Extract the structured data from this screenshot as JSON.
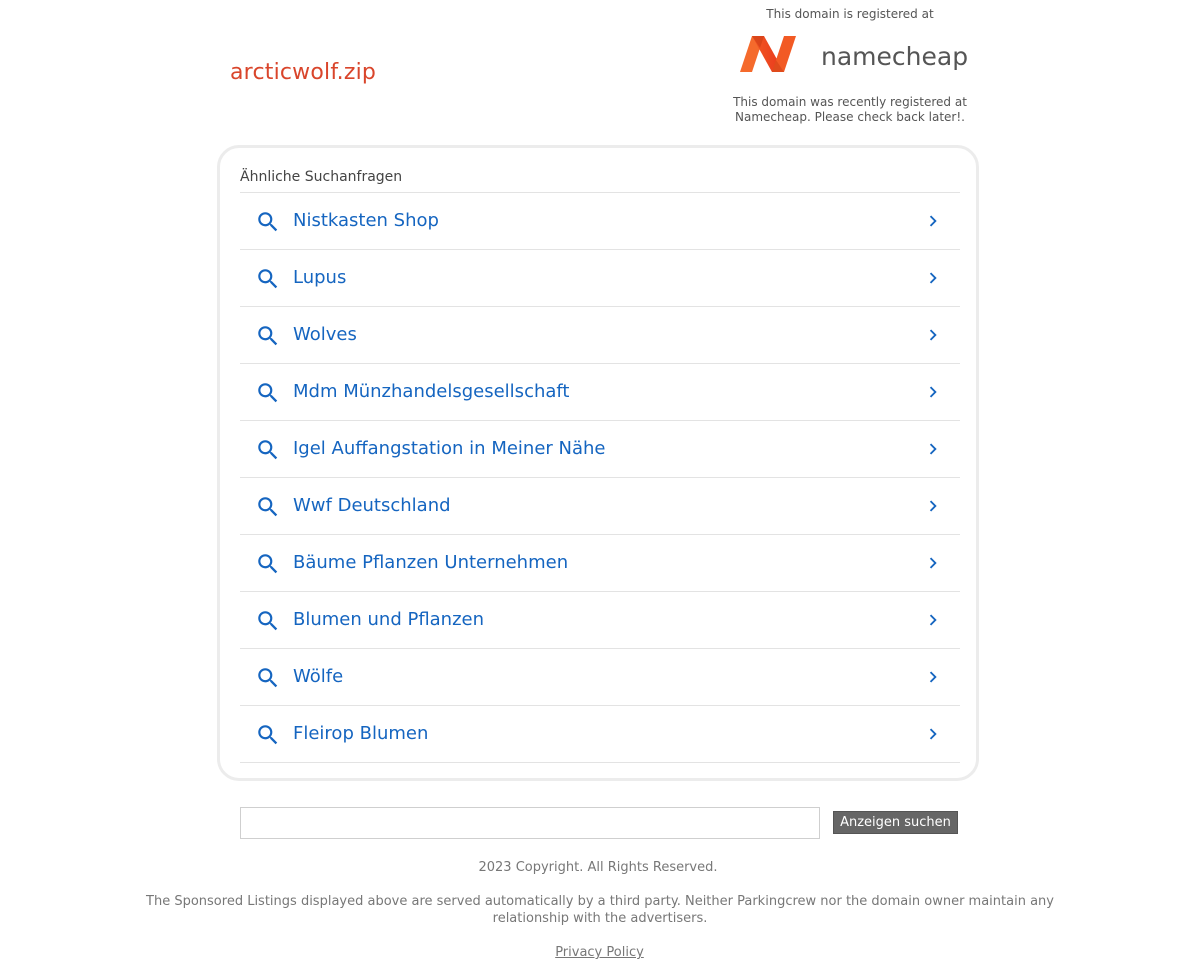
{
  "header": {
    "domain": "arcticwolf.zip",
    "registered_at_text": "This domain is registered at",
    "registrar_logo": {
      "icon": "namecheap-logo",
      "wordmark": "namecheap",
      "brand_color": "#f25a24"
    },
    "registrar_note": "This domain was recently registered at Namecheap. Please check back later!."
  },
  "related": {
    "heading": "Ähnliche Suchanfragen",
    "items": [
      {
        "label": "Nistkasten Shop"
      },
      {
        "label": "Lupus"
      },
      {
        "label": "Wolves"
      },
      {
        "label": "Mdm Münzhandelsgesellschaft"
      },
      {
        "label": "Igel Auffangstation in Meiner Nähe"
      },
      {
        "label": "Wwf Deutschland"
      },
      {
        "label": "Bäume Pflanzen Unternehmen"
      },
      {
        "label": "Blumen und Pflanzen"
      },
      {
        "label": "Wölfe"
      },
      {
        "label": "Fleirop Blumen"
      }
    ],
    "icons": {
      "left": "search-icon",
      "right": "chevron-right-icon"
    },
    "link_color": "#1565c0"
  },
  "search": {
    "input_value": "",
    "button_label": "Anzeigen suchen"
  },
  "footer": {
    "copyright": "2023 Copyright. All Rights Reserved.",
    "disclaimer": "The Sponsored Listings displayed above are served automatically by a third party. Neither Parkingcrew nor the domain owner maintain any relationship with the advertisers.",
    "privacy_label": "Privacy Policy"
  },
  "colors": {
    "domain_title": "#d9452b",
    "button_bg": "#666666"
  }
}
